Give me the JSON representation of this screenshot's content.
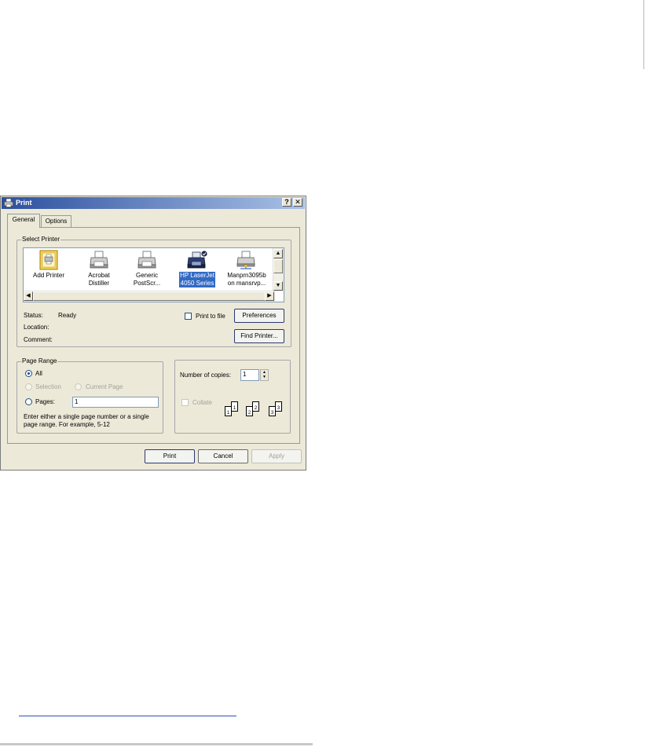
{
  "dialog": {
    "title": "Print",
    "help_button": "?",
    "close_button": "✕"
  },
  "tabs": [
    {
      "label": "General",
      "active": true
    },
    {
      "label": "Options",
      "active": false
    }
  ],
  "select_printer": {
    "legend": "Select Printer",
    "printers": [
      {
        "label": "Add Printer",
        "icon": "add-printer-icon",
        "selected": false
      },
      {
        "label": "Acrobat\nDistiller",
        "icon": "printer-icon",
        "selected": false
      },
      {
        "label": "Generic\nPostScr...",
        "icon": "printer-icon",
        "selected": false
      },
      {
        "label": "HP LaserJet\n4050 Series",
        "icon": "default-printer-icon",
        "selected": true
      },
      {
        "label": "Manprn3095b\non mansrvp...",
        "icon": "network-printer-icon",
        "selected": false
      }
    ],
    "status_label": "Status:",
    "status_value": "Ready",
    "location_label": "Location:",
    "comment_label": "Comment:",
    "print_to_file_label": "Print to file",
    "preferences_label": "Preferences",
    "find_printer_label": "Find Printer..."
  },
  "page_range": {
    "legend": "Page Range",
    "all_label": "All",
    "selection_label": "Selection",
    "current_page_label": "Current Page",
    "pages_label": "Pages:",
    "pages_value": "1",
    "hint": "Enter either a single page number or a single page range.  For example, 5-12"
  },
  "copies": {
    "number_label": "Number of copies:",
    "number_value": "1",
    "collate_label": "Collate"
  },
  "buttons": {
    "print": "Print",
    "cancel": "Cancel",
    "apply": "Apply"
  },
  "colors": {
    "titlebar_start": "#2b4f9e",
    "selection": "#316ac5",
    "dialog_bg": "#ece9d8"
  }
}
